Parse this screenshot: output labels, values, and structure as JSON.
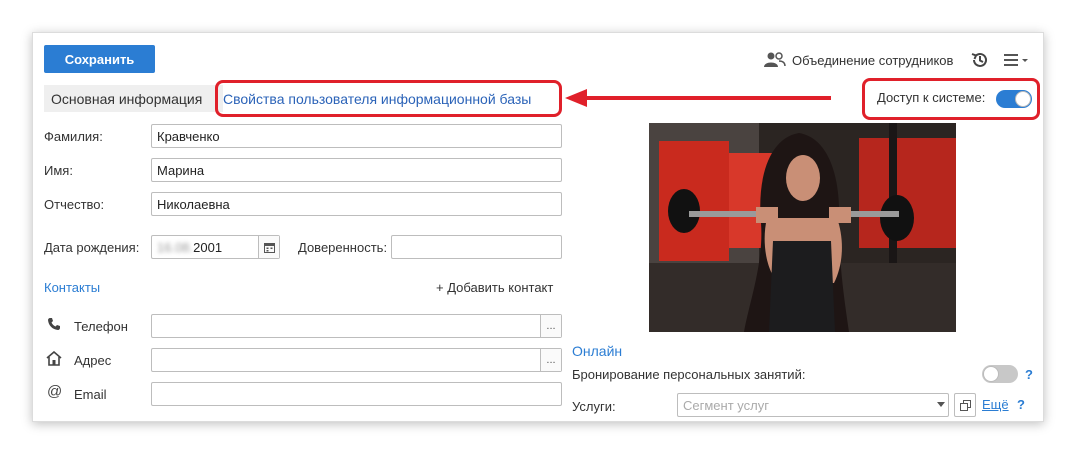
{
  "toolbar": {
    "save_label": "Сохранить",
    "merge_label": "Объединение сотрудников"
  },
  "tabs": {
    "main_label": "Основная информация",
    "db_user_link": "Свойства пользователя информационной базы"
  },
  "access": {
    "label": "Доступ к системе:",
    "enabled": true
  },
  "form": {
    "last_name_label": "Фамилия:",
    "last_name_value": "Кравченко",
    "first_name_label": "Имя:",
    "first_name_value": "Марина",
    "patronymic_label": "Отчество:",
    "patronymic_value": "Николаевна",
    "birth_label": "Дата рождения:",
    "birth_hidden": "16.08.",
    "birth_year": "2001",
    "proxy_label": "Доверенность:",
    "proxy_value": ""
  },
  "contacts": {
    "header": "Контакты",
    "add_label": "+ Добавить контакт",
    "phone_label": "Телефон",
    "phone_value": "",
    "address_label": "Адрес",
    "address_value": "",
    "email_label": "Email",
    "email_value": "",
    "dots": "..."
  },
  "online": {
    "header": "Онлайн",
    "booking_label": "Бронирование персональных занятий:",
    "booking_enabled": false,
    "services_label": "Услуги:",
    "services_placeholder": "Сегмент услуг",
    "more_link": "Ещё",
    "help": "?"
  },
  "colors": {
    "accent": "#2b7dd3",
    "highlight": "#e0202a"
  },
  "icons": {
    "merge": "people-icon",
    "history": "history-icon",
    "menu": "menu-icon",
    "calendar": "calendar-icon",
    "phone": "phone-icon",
    "home": "home-icon",
    "email": "at-icon",
    "copy": "copy-icon"
  }
}
